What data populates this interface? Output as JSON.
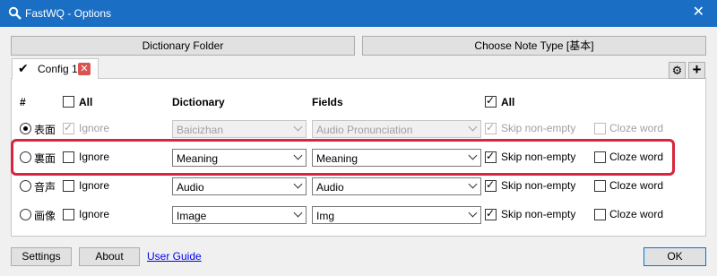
{
  "window": {
    "title": "FastWQ - Options",
    "close_glyph": "✕"
  },
  "top_buttons": {
    "dictionary_folder": "Dictionary Folder",
    "choose_note_type": "Choose Note Type [基本]"
  },
  "tab": {
    "label": "Config 1",
    "close_glyph": "✕",
    "check_glyph": "✔"
  },
  "tab_tools": {
    "settings_glyph": "⚙",
    "add_glyph": "+"
  },
  "headers": {
    "hash": "#",
    "all_left": "All",
    "dictionary": "Dictionary",
    "fields": "Fields",
    "all_right": "All"
  },
  "rows": [
    {
      "field": "表面",
      "ignore": "Ignore",
      "dictionary": "Baicizhan",
      "dict_field": "Audio Pronunciation",
      "skip": "Skip non-empty",
      "cloze": "Cloze word"
    },
    {
      "field": "裏面",
      "ignore": "Ignore",
      "dictionary": "Meaning",
      "dict_field": "Meaning",
      "skip": "Skip non-empty",
      "cloze": "Cloze word"
    },
    {
      "field": "音声",
      "ignore": "Ignore",
      "dictionary": "Audio",
      "dict_field": "Audio",
      "skip": "Skip non-empty",
      "cloze": "Cloze word"
    },
    {
      "field": "画像",
      "ignore": "Ignore",
      "dictionary": "Image",
      "dict_field": "Img",
      "skip": "Skip non-empty",
      "cloze": "Cloze word"
    }
  ],
  "bottom": {
    "settings": "Settings",
    "about": "About",
    "user_guide": "User Guide",
    "ok": "OK"
  },
  "colors": {
    "titlebar": "#1a6fc4",
    "highlight": "#d7263d",
    "link": "#0000ee"
  }
}
